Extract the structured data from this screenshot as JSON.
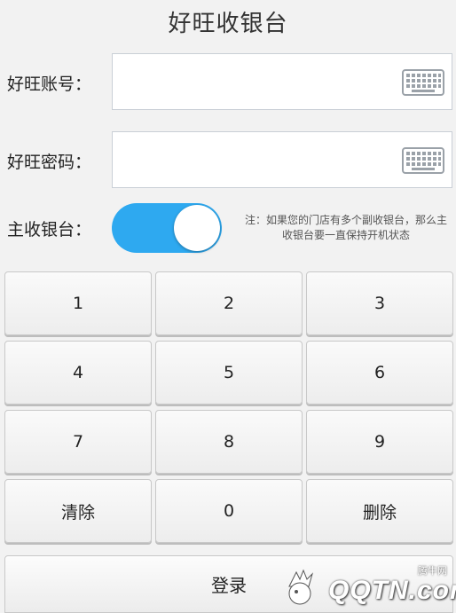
{
  "header": {
    "title": "好旺收银台"
  },
  "account": {
    "label": "好旺账号：",
    "value": "",
    "keyboard_icon": "keyboard-icon"
  },
  "password": {
    "label": "好旺密码：",
    "value": "",
    "keyboard_icon": "keyboard-icon"
  },
  "main_register": {
    "label": "主收银台：",
    "toggle_on": true,
    "toggle_color": "#2ea9f0",
    "note": "注：如果您的门店有多个副收银台，那么主收银台要一直保持开机状态"
  },
  "keypad": {
    "keys": [
      "1",
      "2",
      "3",
      "4",
      "5",
      "6",
      "7",
      "8",
      "9",
      "清除",
      "0",
      "删除"
    ]
  },
  "login": {
    "label": "登录"
  },
  "watermark": {
    "logo_text": "QQTN.com",
    "small_text": "腾牛网"
  }
}
